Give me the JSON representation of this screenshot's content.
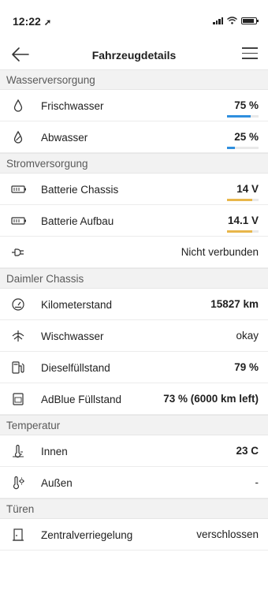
{
  "status": {
    "time": "12:22",
    "location_arrow": "➚"
  },
  "nav": {
    "title": "Fahrzeugdetails"
  },
  "sections": {
    "water": "Wasserversorgung",
    "power": "Stromversorgung",
    "chassis": "Daimler Chassis",
    "temp": "Temperatur",
    "doors": "Türen"
  },
  "water": {
    "fresh": {
      "label": "Frischwasser",
      "value": "75 %",
      "level": 0.75,
      "color": "#2f8fde"
    },
    "waste": {
      "label": "Abwasser",
      "value": "25 %",
      "level": 0.25,
      "color": "#2f8fde"
    }
  },
  "power": {
    "chassis_batt": {
      "label": "Batterie Chassis",
      "value": "14 V",
      "level": 0.8,
      "color": "#e8b64a"
    },
    "body_batt": {
      "label": "Batterie Aufbau",
      "value": "14.1 V",
      "level": 0.8,
      "color": "#e8b64a"
    },
    "plug": {
      "value": "Nicht verbunden"
    }
  },
  "chassis": {
    "km": {
      "label": "Kilometerstand",
      "value": "15827 km"
    },
    "wiper": {
      "label": "Wischwasser",
      "value": "okay"
    },
    "diesel": {
      "label": "Dieselfüllstand",
      "value": "79 %"
    },
    "adblue": {
      "label": "AdBlue Füllstand",
      "value": "73 % (6000 km left)"
    }
  },
  "temp": {
    "inside": {
      "label": "Innen",
      "value": "23 C"
    },
    "outside": {
      "label": "Außen",
      "value": "-"
    }
  },
  "doors": {
    "lock": {
      "label": "Zentralverriegelung",
      "value": "verschlossen"
    }
  }
}
